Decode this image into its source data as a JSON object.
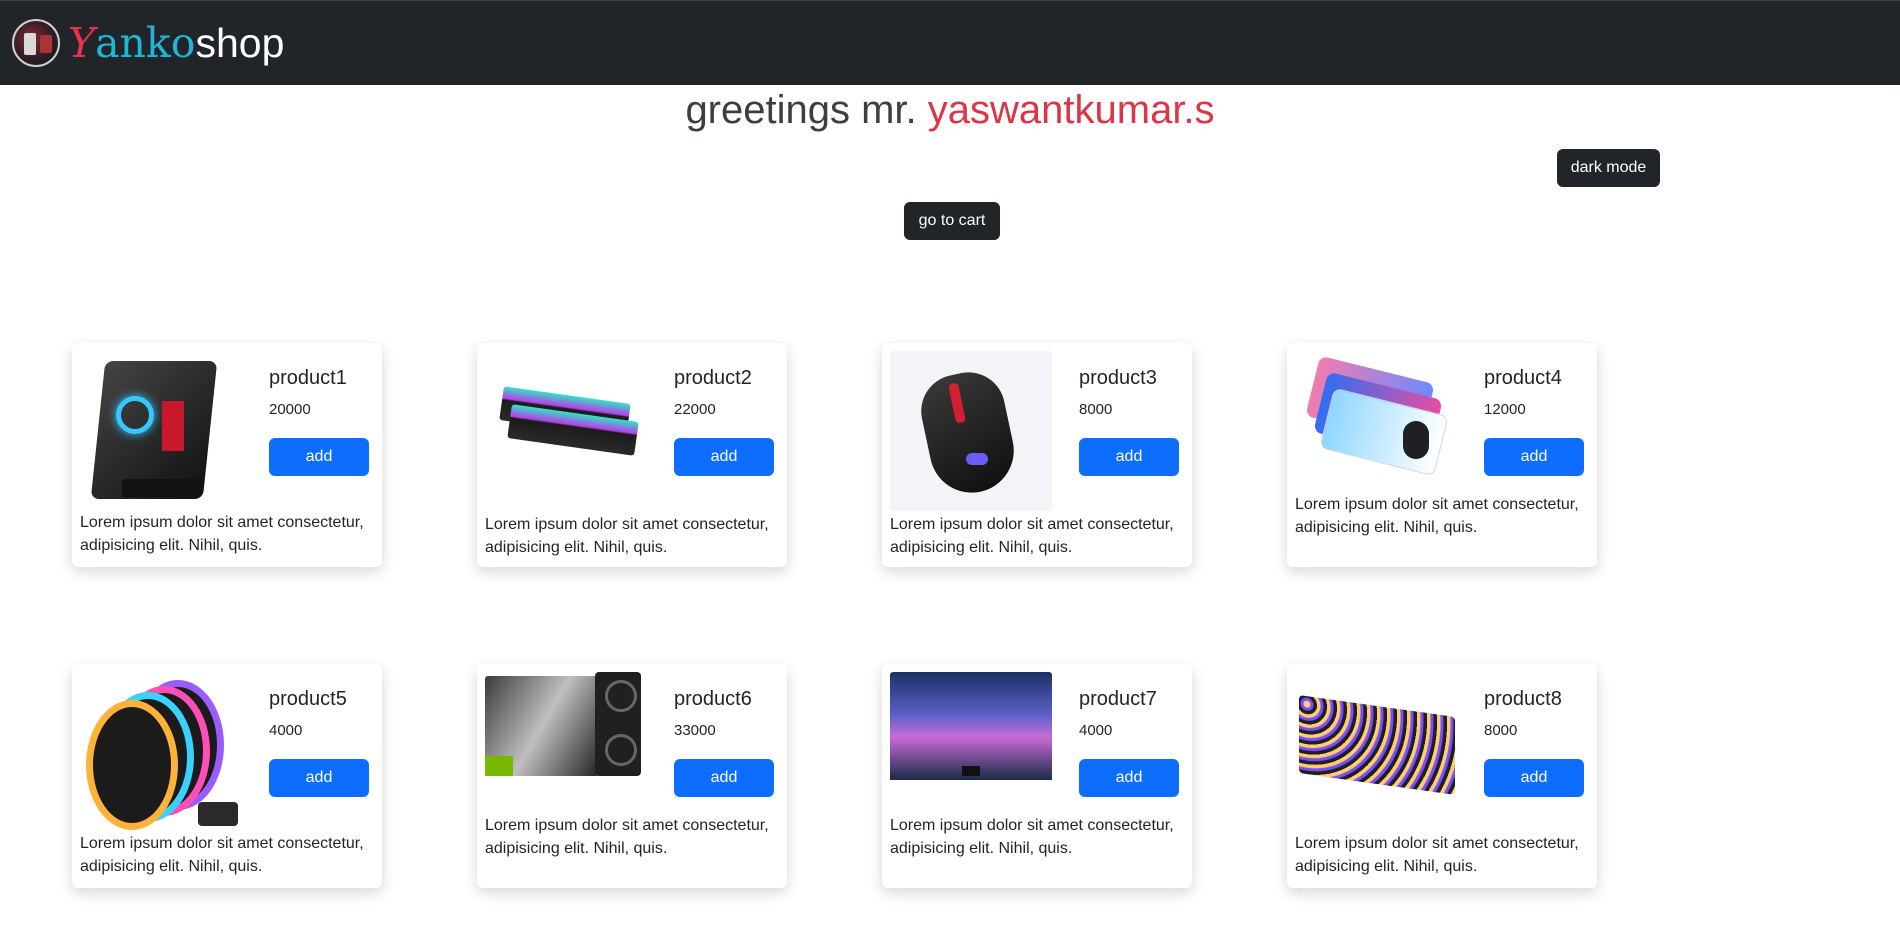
{
  "navbar": {
    "brand_y": "Y",
    "brand_anko": "anko",
    "brand_shop": "shop",
    "logo_icon": "profile-avatar-icon"
  },
  "greeting": {
    "prefix": "greetings mr. ",
    "username": "yaswantkumar.s"
  },
  "buttons": {
    "dark_mode": "dark mode",
    "go_to_cart": "go to cart"
  },
  "products": [
    {
      "title": "product1",
      "price": "20000",
      "add": "add",
      "desc": "Lorem ipsum dolor sit amet consectetur, adipisicing elit. Nihil, quis.",
      "image": "pc-case-image"
    },
    {
      "title": "product2",
      "price": "22000",
      "add": "add",
      "desc": "Lorem ipsum dolor sit amet consectetur, adipisicing elit. Nihil, quis.",
      "image": "ram-image"
    },
    {
      "title": "product3",
      "price": "8000",
      "add": "add",
      "desc": "Lorem ipsum dolor sit amet consectetur, adipisicing elit. Nihil, quis.",
      "image": "gaming-mouse-image"
    },
    {
      "title": "product4",
      "price": "12000",
      "add": "add",
      "desc": "Lorem ipsum dolor sit amet consectetur, adipisicing elit. Nihil, quis.",
      "image": "mousepad-image"
    },
    {
      "title": "product5",
      "price": "4000",
      "add": "add",
      "desc": "Lorem ipsum dolor sit amet consectetur, adipisicing elit. Nihil, quis.",
      "image": "rgb-fans-image"
    },
    {
      "title": "product6",
      "price": "33000",
      "add": "add",
      "desc": "Lorem ipsum dolor sit amet consectetur, adipisicing elit. Nihil, quis.",
      "image": "graphics-card-image"
    },
    {
      "title": "product7",
      "price": "4000",
      "add": "add",
      "desc": "Lorem ipsum dolor sit amet consectetur, adipisicing elit. Nihil, quis.",
      "image": "monitor-image"
    },
    {
      "title": "product8",
      "price": "8000",
      "add": "add",
      "desc": "Lorem ipsum dolor sit amet consectetur, adipisicing elit. Nihil, quis.",
      "image": "keyboard-image"
    }
  ],
  "colors": {
    "navbar_bg": "#212529",
    "brand_y": "#e8314b",
    "brand_anko": "#1fb6d6",
    "username": "#dc3545",
    "add_button": "#0d6efd",
    "dark_button": "#212529"
  }
}
